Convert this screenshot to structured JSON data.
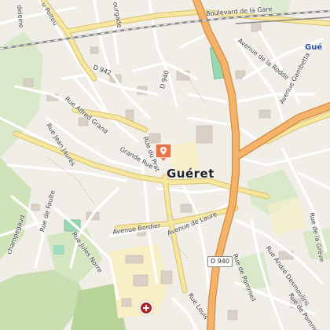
{
  "map": {
    "city_label": "Guéret",
    "partial_labels": {
      "top_right": "Gué",
      "top_left": "deleine",
      "poitou": "u Poitou",
      "top_mid": "ourgade"
    },
    "roads": {
      "boulevard_gare": "Boulevard de la Gare",
      "d942": "D 942",
      "d940_north": "D 940",
      "rue_rodde": "Avenue de la Rodde",
      "ave_gambetta": "Avenue Gambetta",
      "rue_alfred_grand": "Rue Alfred Grand",
      "rue_jean_jaures": "Rue Jean Jaurès",
      "grande_rue": "Grande Rue",
      "rue_du_prat": "Rue du Prat",
      "rue_de_faulte": "Rue de Faulte",
      "champegaud": "champegaud",
      "rue_jules_norre": "Rue Jules Norre",
      "avenue_bordier": "Avenue Bordier",
      "avenue_laure": "Avenue de Laure",
      "rue_de_pommeil": "Rue de Pommeil",
      "rue_andre_desmoulins": "Rue André Desmoulins",
      "rue_de_la_greve": "Rue de la Grève",
      "rue_louis": "Rue Louis",
      "rue_de_pommeil_2": "Rue de Pommeil"
    },
    "shield_d940": "D 940",
    "marker": {
      "icon": "location-pin-icon",
      "color": "#e8744a"
    },
    "hospital": {
      "icon": "hospital-cross-icon",
      "color": "#a6262c"
    }
  }
}
